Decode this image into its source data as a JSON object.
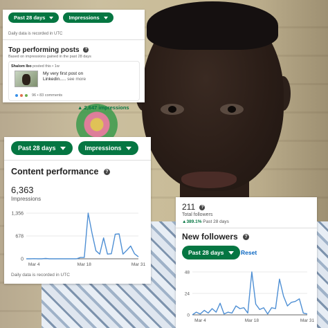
{
  "posts_card": {
    "filter_period": "Past 28 days",
    "filter_metric": "Impressions",
    "utc_note": "Daily data is recorded in UTC",
    "title": "Top performing posts",
    "subtitle": "Based on impressions gained in the past 28 days",
    "post": {
      "author": "Shalom Ibo",
      "meta": "posted this • 1w",
      "text": "My very first post on Linkedin.....",
      "see_more": "see more",
      "reactions": "96 • 83 comments",
      "impressions": "2,647 impressions"
    }
  },
  "content_card": {
    "filter_period": "Past 28 days",
    "filter_metric": "Impressions",
    "title": "Content performance",
    "value": "6,363",
    "value_label": "Impressions",
    "footnote": "Daily data is recorded in UTC"
  },
  "followers_card": {
    "total": "211",
    "total_label": "Total followers",
    "growth": "389.1%",
    "growth_period": "Past 28 days",
    "title": "New followers",
    "filter_period": "Past 28 days",
    "reset_label": "Reset"
  },
  "icons": {
    "caret": "chevron-down-icon",
    "help": "question-icon",
    "growth": "arrow-up-icon"
  },
  "colors": {
    "accent_green": "#057642",
    "line_blue": "#4e8fd4",
    "link_blue": "#0a66c2"
  },
  "chart_data": [
    {
      "type": "line",
      "x_ticks": [
        "Mar 4",
        "Mar 18",
        "Mar 31"
      ],
      "y_ticks": [
        "0",
        "678",
        "1,356"
      ],
      "ylim": [
        0,
        1356
      ],
      "series": [
        {
          "values": [
            0,
            0,
            5,
            0,
            0,
            10,
            0,
            0,
            0,
            0,
            0,
            0,
            0,
            0,
            40,
            40,
            1356,
            760,
            240,
            140,
            620,
            140,
            150,
            730,
            740,
            140,
            250,
            380,
            150,
            60
          ]
        }
      ]
    },
    {
      "type": "line",
      "x_ticks": [
        "Mar 4",
        "Mar 18",
        "Mar 31"
      ],
      "y_ticks": [
        "0",
        "24",
        "48"
      ],
      "ylim": [
        0,
        48
      ],
      "series": [
        {
          "values": [
            0,
            3,
            1,
            5,
            2,
            7,
            3,
            13,
            1,
            3,
            2,
            10,
            7,
            8,
            2,
            48,
            12,
            6,
            8,
            1,
            8,
            7,
            40,
            21,
            10,
            14,
            15,
            18,
            2,
            1
          ]
        }
      ]
    }
  ]
}
